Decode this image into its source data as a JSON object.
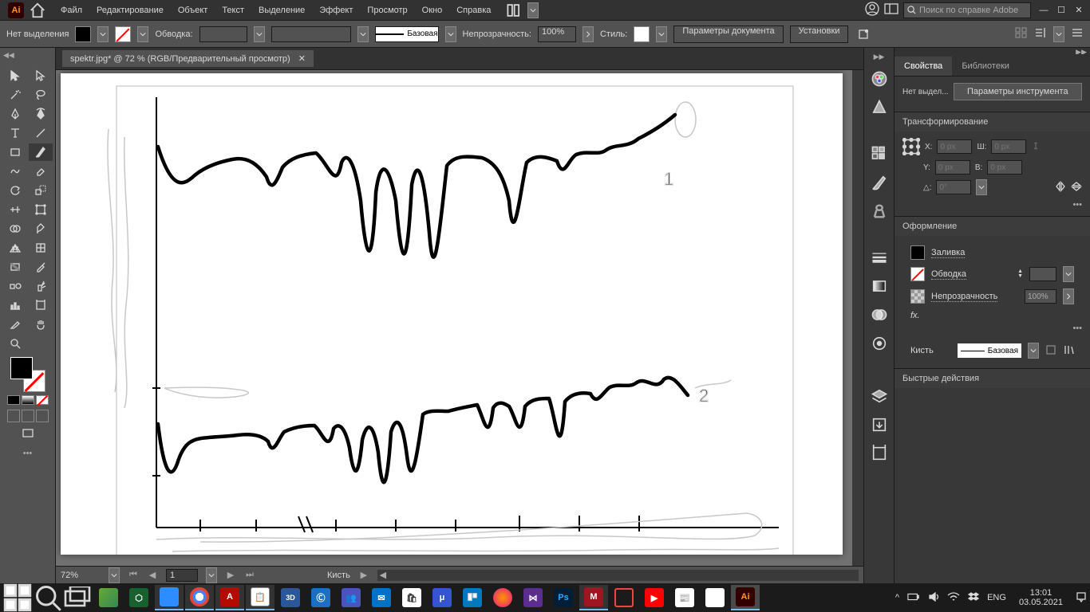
{
  "app": {
    "logo": "Ai"
  },
  "menu": [
    "Файл",
    "Редактирование",
    "Объект",
    "Текст",
    "Выделение",
    "Эффект",
    "Просмотр",
    "Окно",
    "Справка"
  ],
  "search": {
    "placeholder": "Поиск по справке Adobe"
  },
  "controlbar": {
    "noSelection": "Нет выделения",
    "strokeLabel": "Обводка:",
    "strokePresetLabel": "Базовая",
    "opacityLabel": "Непрозрачность:",
    "opacityValue": "100%",
    "styleLabel": "Стиль:",
    "docSettingsBtn": "Параметры документа",
    "prefsBtn": "Установки"
  },
  "docTab": {
    "title": "spektr.jpg* @ 72 % (RGB/Предварительный просмотр)"
  },
  "status": {
    "zoom": "72%",
    "artboard": "1",
    "tool": "Кисть"
  },
  "panels": {
    "tab1": "Свойства",
    "tab2": "Библиотеки",
    "noSelShort": "Нет выдел...",
    "instrParamsBtn": "Параметры инструмента",
    "transformHead": "Трансформирование",
    "xLabel": "X:",
    "yLabel": "Y:",
    "wLabel": "Ш:",
    "hLabel": "В:",
    "angleLabel": "△:",
    "placeholder0": "0 px",
    "placeholder0deg": "0°",
    "appearanceHead": "Оформление",
    "fillLabel": "Заливка",
    "strokeLabel": "Обводка",
    "opacityLabel": "Непрозрачность",
    "opacityValue": "100%",
    "fxLabel": "fx.",
    "brushLabel": "Кисть",
    "brushName": "Базовая",
    "quickActions": "Быстрые действия"
  },
  "taskbar": {
    "lang": "ENG",
    "time": "13:01",
    "date": "03.05.2021"
  },
  "canvas_labels": {
    "one": "1",
    "two": "2"
  }
}
